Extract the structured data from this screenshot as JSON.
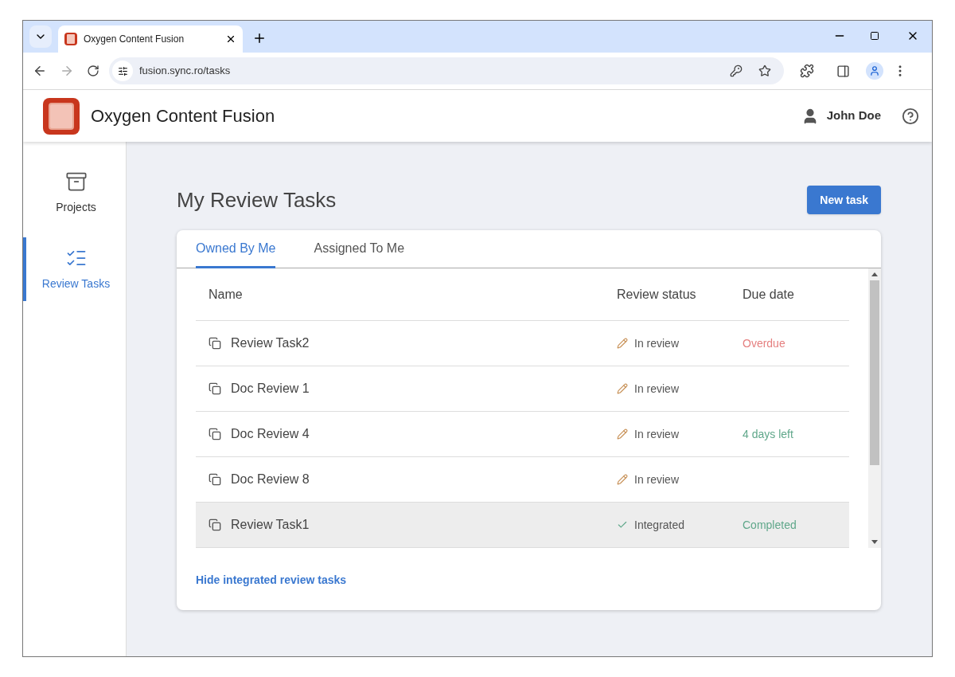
{
  "browser": {
    "tab_title": "Oxygen Content Fusion",
    "url": "fusion.sync.ro/tasks"
  },
  "header": {
    "app_title": "Oxygen Content Fusion",
    "user": "John Doe"
  },
  "sidebar": {
    "items": [
      {
        "kind": "projects",
        "label": "Projects",
        "selected": false
      },
      {
        "kind": "tasks",
        "label": "Review Tasks",
        "selected": true
      }
    ]
  },
  "page_title": "My Review Tasks",
  "new_task_button": "New task",
  "tabs": [
    {
      "label": "Owned By Me",
      "selected": true
    },
    {
      "label": "Assigned To Me",
      "selected": false
    }
  ],
  "table": {
    "columns": [
      "Name",
      "Review status",
      "Due date"
    ],
    "rows": [
      {
        "name": "Review Task2",
        "status": {
          "kind": "review",
          "label": "In review"
        },
        "due": {
          "label": "Overdue",
          "color": "#e57f7f"
        },
        "selected": false
      },
      {
        "name": "Doc Review 1",
        "status": {
          "kind": "review",
          "label": "In review"
        },
        "selected": false
      },
      {
        "name": "Doc Review 4",
        "status": {
          "kind": "review",
          "label": "In review"
        },
        "due": {
          "label": "4 days left",
          "color": "#5fa78a"
        },
        "selected": false
      },
      {
        "name": "Doc Review 8",
        "status": {
          "kind": "review",
          "label": "In review"
        },
        "selected": false
      },
      {
        "name": "Review Task1",
        "status": {
          "kind": "integrated",
          "label": "Integrated"
        },
        "due": {
          "label": "Completed",
          "color": "#5fa78a"
        },
        "selected": true
      }
    ]
  },
  "footer_link": "Hide integrated review tasks"
}
